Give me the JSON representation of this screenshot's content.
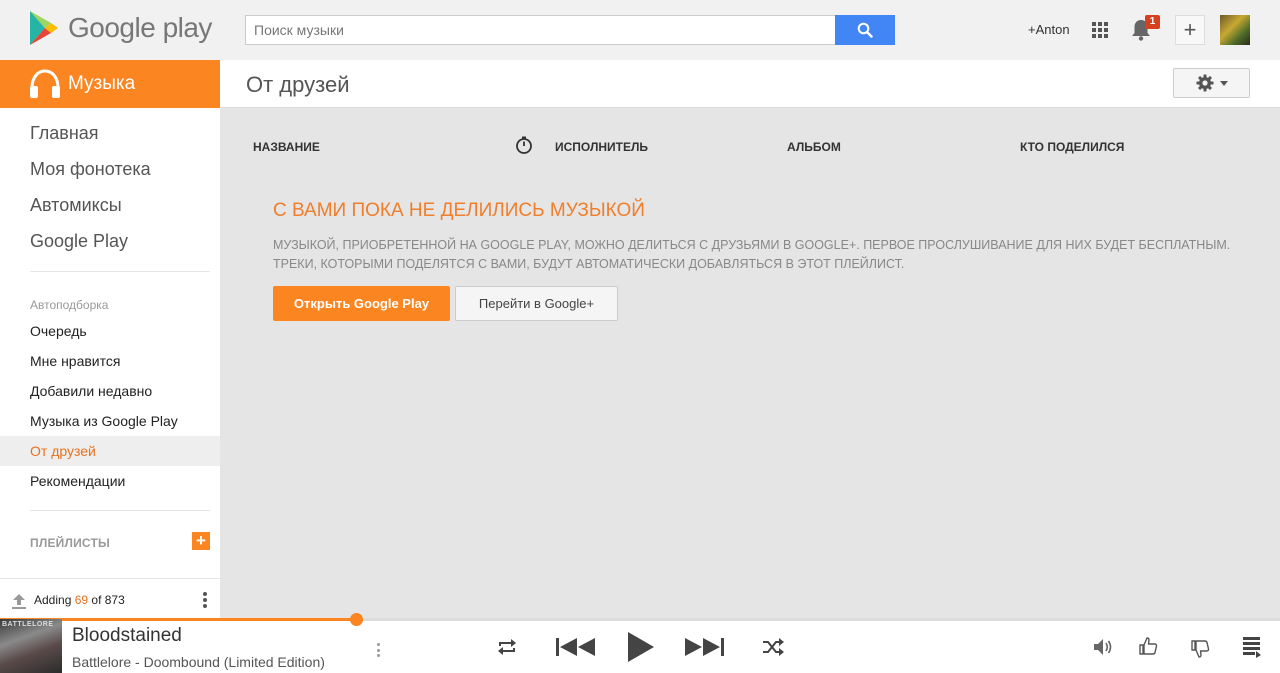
{
  "header": {
    "logo_text": "Google play",
    "search_placeholder": "Поиск музыки",
    "user_name": "+Anton",
    "notification_count": "1"
  },
  "sidebar": {
    "section_title": "Музыка",
    "main_items": [
      {
        "label": "Главная"
      },
      {
        "label": "Моя фонотека"
      },
      {
        "label": "Автомиксы"
      },
      {
        "label": "Google Play"
      }
    ],
    "auto_label": "Автоподборка",
    "auto_items": [
      {
        "label": "Очередь"
      },
      {
        "label": "Мне нравится"
      },
      {
        "label": "Добавили недавно"
      },
      {
        "label": "Музыка из Google Play"
      },
      {
        "label": "От друзей",
        "active": true
      },
      {
        "label": "Рекомендации"
      }
    ],
    "playlists_label": "ПЛЕЙЛИСТЫ",
    "upload": {
      "prefix": "Adding ",
      "count": "69",
      "suffix": " of 873"
    }
  },
  "main": {
    "page_title": "От друзей",
    "columns": [
      "НАЗВАНИЕ",
      "ИСПОЛНИТЕЛЬ",
      "АЛЬБОМ",
      "КТО ПОДЕЛИЛСЯ"
    ],
    "empty_title": "С ВАМИ ПОКА НЕ ДЕЛИЛИСЬ МУЗЫКОЙ",
    "empty_desc": "Музыкой, приобретенной на Google Play, можно делиться с друзьями в Google+. Первое прослушивание для них будет бесплатным. Треки, которыми поделятся с вами, будут автоматически добавляться в этот плейлист.",
    "primary_button": "Открыть Google Play",
    "secondary_button": "Перейти в Google+"
  },
  "player": {
    "album_art_text": "BATTLELORE",
    "song_title": "Bloodstained",
    "song_artist": "Battlelore - Doombound (Limited Edition)",
    "progress_fraction": 0.278
  },
  "colors": {
    "accent": "#fb8521",
    "search_button": "#4285f4",
    "badge": "#d6411e"
  }
}
